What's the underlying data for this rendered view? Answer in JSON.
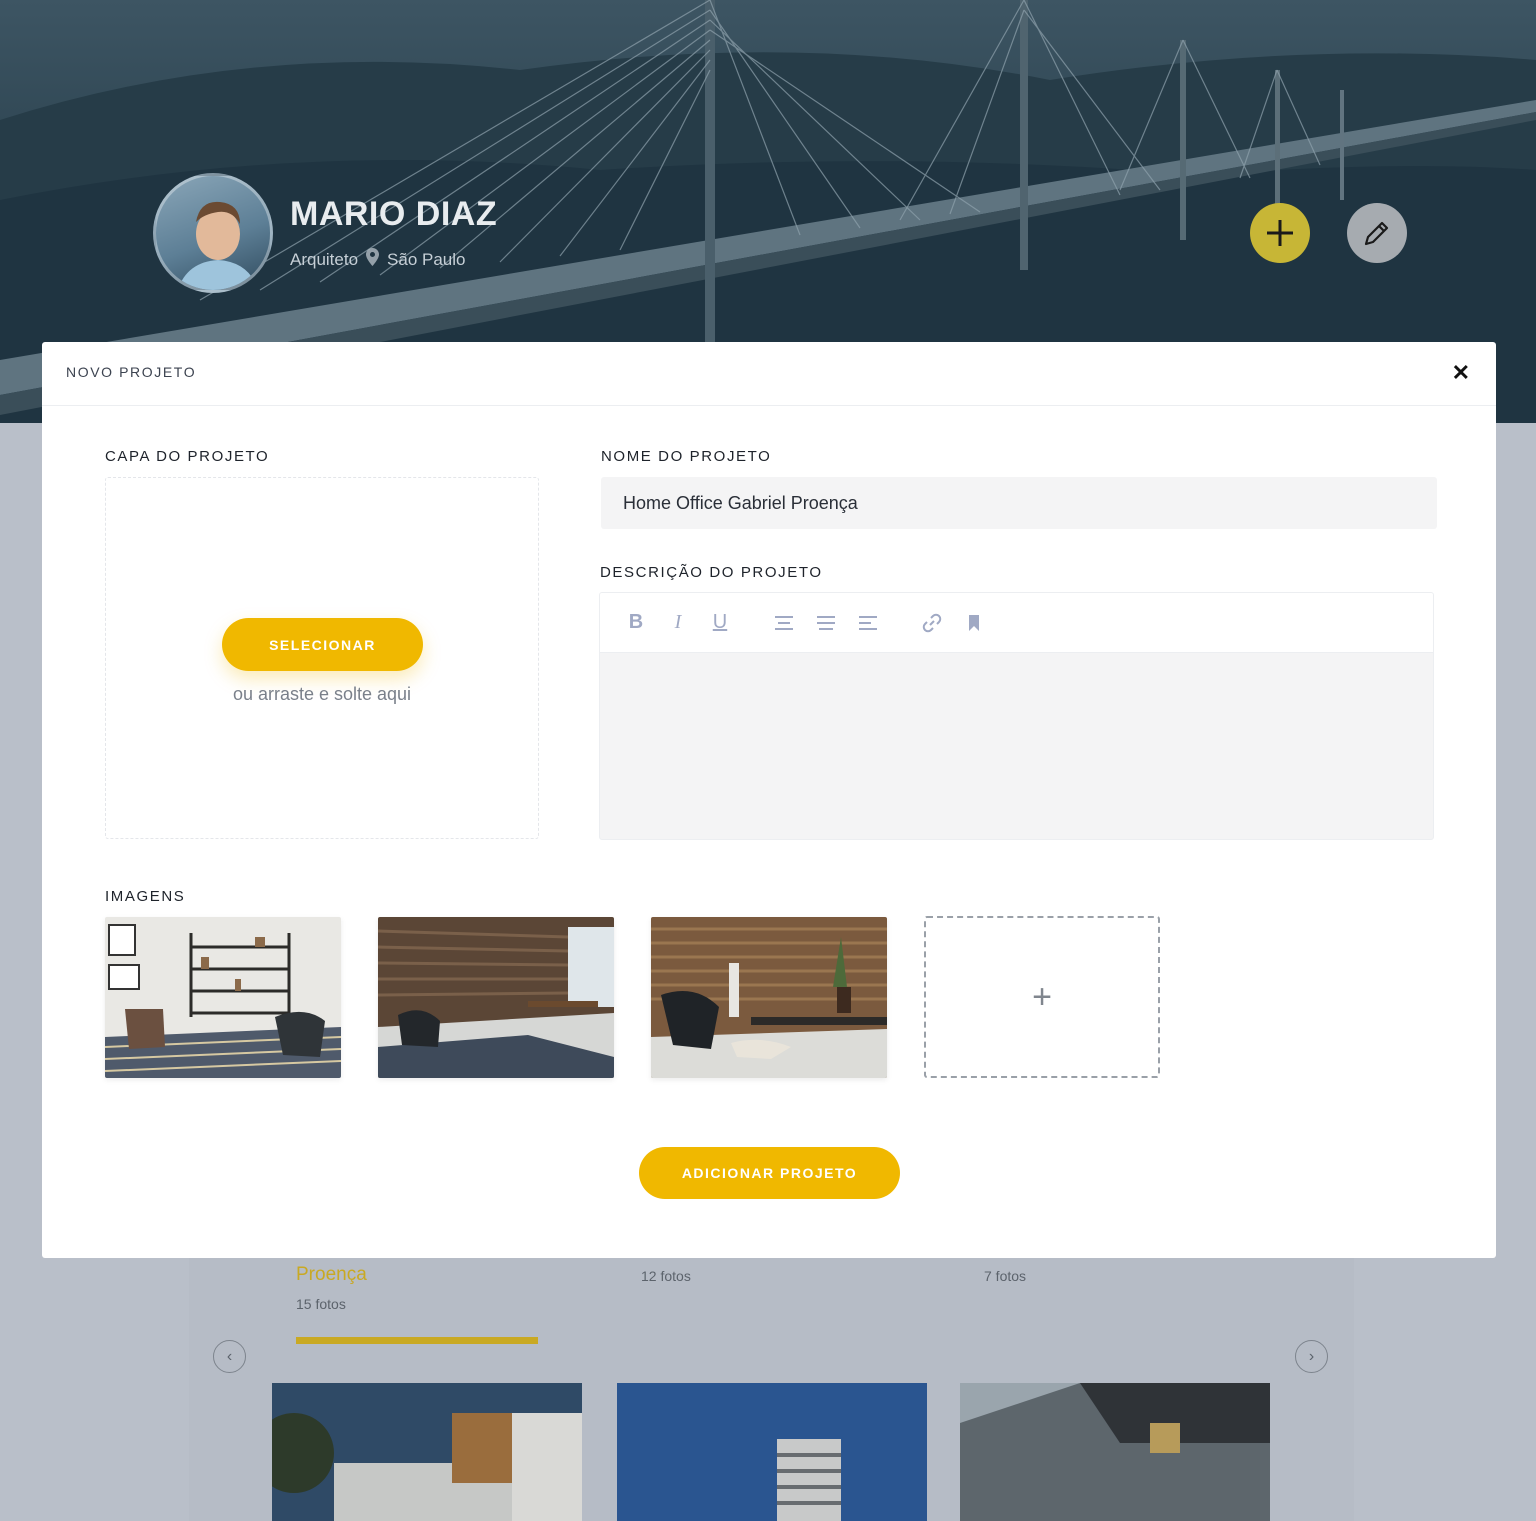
{
  "profile": {
    "name": "MARIO DIAZ",
    "role": "Arquiteto",
    "location": "São Paulo"
  },
  "hero_actions": {
    "add_icon": "plus-icon",
    "edit_icon": "pencil-icon"
  },
  "modal": {
    "title": "NOVO PROJETO",
    "close_icon": "close-icon",
    "cover": {
      "label": "CAPA DO PROJETO",
      "button": "SELECIONAR",
      "hint": "ou arraste e solte aqui"
    },
    "name": {
      "label": "NOME DO PROJETO",
      "value": "Home Office Gabriel Proença"
    },
    "description": {
      "label": "DESCRIÇÃO DO PROJETO",
      "toolbar": [
        "bold-icon",
        "italic-icon",
        "underline-icon",
        "align-center-icon",
        "align-justify-icon",
        "align-left-icon",
        "link-icon",
        "bookmark-icon"
      ],
      "value": ""
    },
    "images": {
      "label": "IMAGENS",
      "add_symbol": "+"
    },
    "submit": "ADICIONAR PROJETO"
  },
  "background_page": {
    "project_title": "Proença",
    "counts": [
      "15 fotos",
      "12 fotos",
      "7 fotos"
    ],
    "prev": "‹",
    "next": "›"
  },
  "colors": {
    "accent": "#f0b800",
    "hero_add": "#c7b636",
    "hero_edit": "#a6abb0",
    "overlay": "#b9bfc9"
  }
}
